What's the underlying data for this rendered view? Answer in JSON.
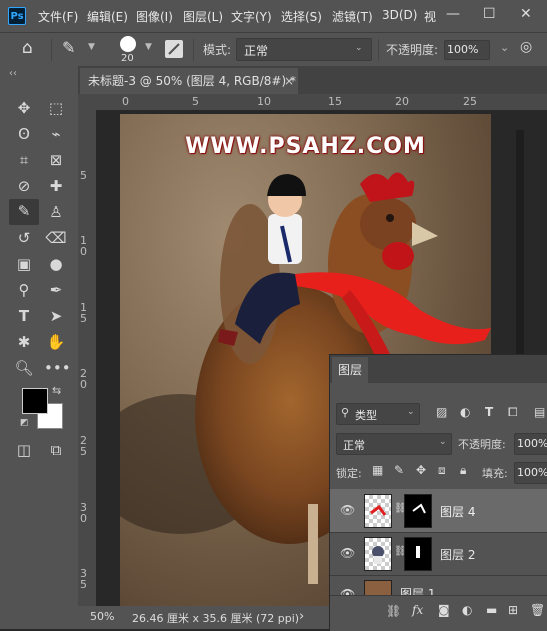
{
  "app": {
    "logo": "Ps"
  },
  "menu": [
    "文件(F)",
    "编辑(E)",
    "图像(I)",
    "图层(L)",
    "文字(Y)",
    "选择(S)",
    "滤镜(T)",
    "3D(D)",
    "视"
  ],
  "window_controls": {
    "minimize": "—",
    "maximize": "☐",
    "close": "✕"
  },
  "options": {
    "brush_size": "20",
    "mode_label": "模式:",
    "mode_value": "正常",
    "opacity_label": "不透明度:",
    "opacity_value": "100%"
  },
  "toolbar": {
    "collapse": "‹‹"
  },
  "document_tab": {
    "title": "未标题-3 @ 50% (图层 4, RGB/8#) *",
    "close": "×"
  },
  "ruler_top": [
    "0",
    "5",
    "10",
    "15",
    "20",
    "25"
  ],
  "ruler_left": [
    "5",
    "1 0",
    "1 5",
    "2 0",
    "2 5",
    "3 0",
    "3 5"
  ],
  "canvas": {
    "watermark": "WWW.PSAHZ.COM"
  },
  "status": {
    "zoom": "50%",
    "doc_info": "26.46 厘米 x 35.6 厘米 (72 ppi)",
    "arrow": "›"
  },
  "layers_panel": {
    "tab": "图层",
    "filter_kind": "类型",
    "blend_mode": "正常",
    "opacity_label": "不透明度:",
    "opacity_value": "100%",
    "lock_label": "锁定:",
    "fill_label": "填充:",
    "fill_value": "100%",
    "layers": [
      {
        "name": "图层 4",
        "selected": true
      },
      {
        "name": "图层 2",
        "selected": false
      },
      {
        "name": "图层 1",
        "selected": false
      }
    ],
    "footer_fx": "fx"
  },
  "colors": {
    "foreground": "#000000",
    "background": "#ffffff",
    "accent": "#31a8ff",
    "watermark": "#ffffff"
  }
}
